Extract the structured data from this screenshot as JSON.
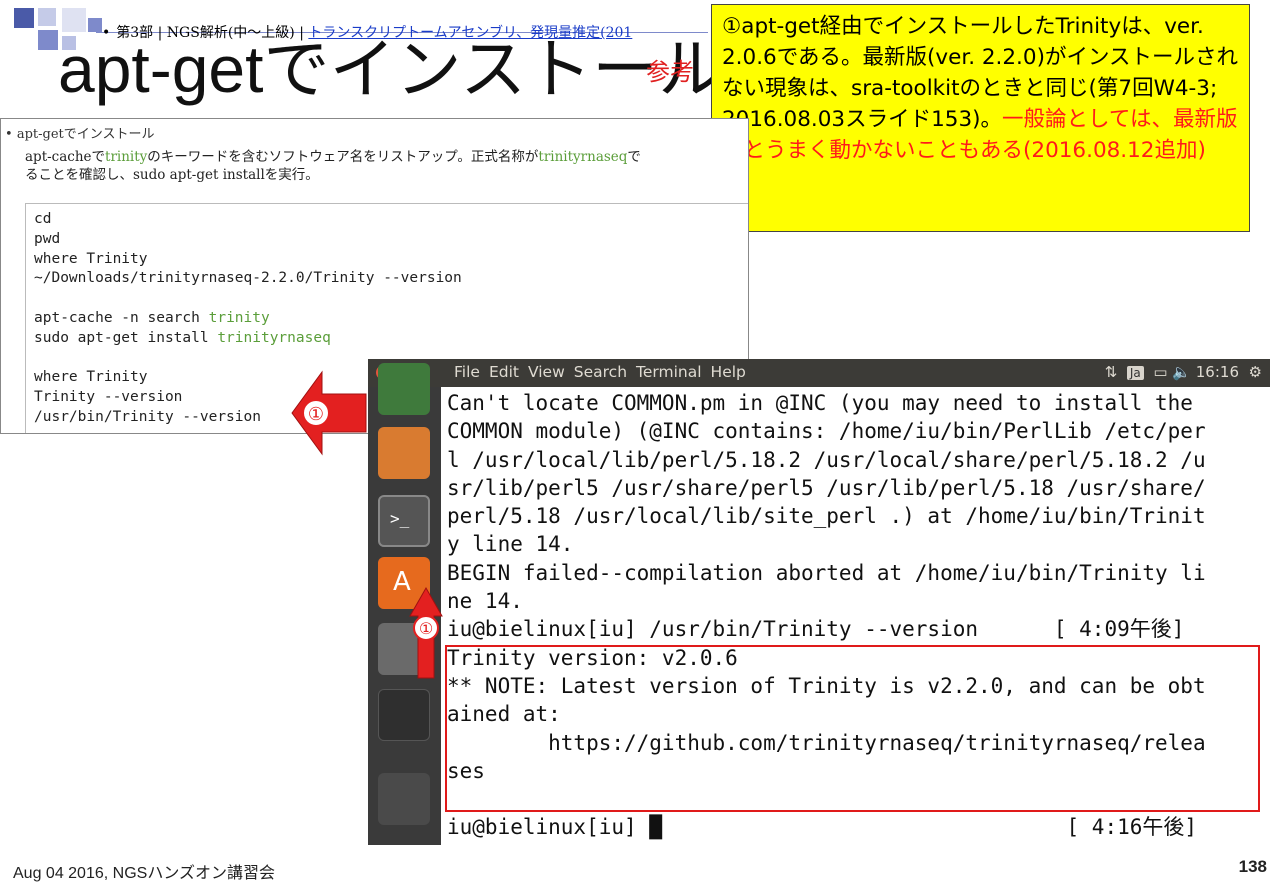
{
  "breadcrumb": {
    "prefix": "第3部 | NGS解析(中～上級) | ",
    "link": "トランスクリプトームアセンブリ、発現量推定(201"
  },
  "slide": {
    "title": "apt-getでインストール",
    "badge": "参考",
    "page_number": "138",
    "footer": "Aug 04 2016, NGSハンズオン講習会"
  },
  "note": {
    "text_black": "①apt-get経由でインストールしたTrinityは、ver. 2.0.6である。最新版(ver. 2.2.0)がインストールされない現象は、sra-toolkitのときと同じ(第7回W4-3; 2016.08.03スライド153)。",
    "text_red": "一般論としては、最新版だとうまく動かないこともある(2016.08.12追加)"
  },
  "panel": {
    "heading": "apt-getでインストール",
    "desc_1": "apt-cacheで",
    "desc_green_1": "trinity",
    "desc_2": "のキーワードを含むソフトウェア名をリストアップ。正式名称が",
    "desc_green_2": "trinityrnaseq",
    "desc_3": "で",
    "desc_4": "ることを確認し、sudo apt-get installを実行。",
    "code_lines": [
      "cd",
      "pwd",
      "where Trinity",
      "~/Downloads/trinityrnaseq-2.2.0/Trinity --version",
      "",
      "apt-cache -n search ",
      "sudo apt-get install ",
      "",
      "where Trinity",
      "Trinity --version",
      "/usr/bin/Trinity --version"
    ],
    "code_green": [
      "trinity",
      "trinityrnaseq"
    ]
  },
  "markers": {
    "circled_one": "①"
  },
  "terminal": {
    "menu": [
      "File",
      "Edit",
      "View",
      "Search",
      "Terminal",
      "Help"
    ],
    "tray": {
      "input_method": "Ja",
      "clock": "16:16"
    },
    "output": "Can't locate COMMON.pm in @INC (you may need to install the\nCOMMON module) (@INC contains: /home/iu/bin/PerlLib /etc/per\nl /usr/local/lib/perl/5.18.2 /usr/local/share/perl/5.18.2 /u\nsr/lib/perl5 /usr/share/perl5 /usr/lib/perl/5.18 /usr/share/\nperl/5.18 /usr/local/lib/site_perl .) at /home/iu/bin/Trinit\ny line 14.\nBEGIN failed--compilation aborted at /home/iu/bin/Trinity li\nne 14.\niu@bielinux[iu] /usr/bin/Trinity --version      [ 4:09午後]\nTrinity version: v2.0.6\n** NOTE: Latest version of Trinity is v2.2.0, and can be obt\nained at:\n        https://github.com/trinityrnaseq/trinityrnaseq/relea\nses\n\niu@bielinux[iu] █                                [ 4:16午後]"
  },
  "colors": {
    "note_bg": "#ffff00",
    "accent_red": "#e01a1a",
    "code_green": "#5b9e3a"
  }
}
